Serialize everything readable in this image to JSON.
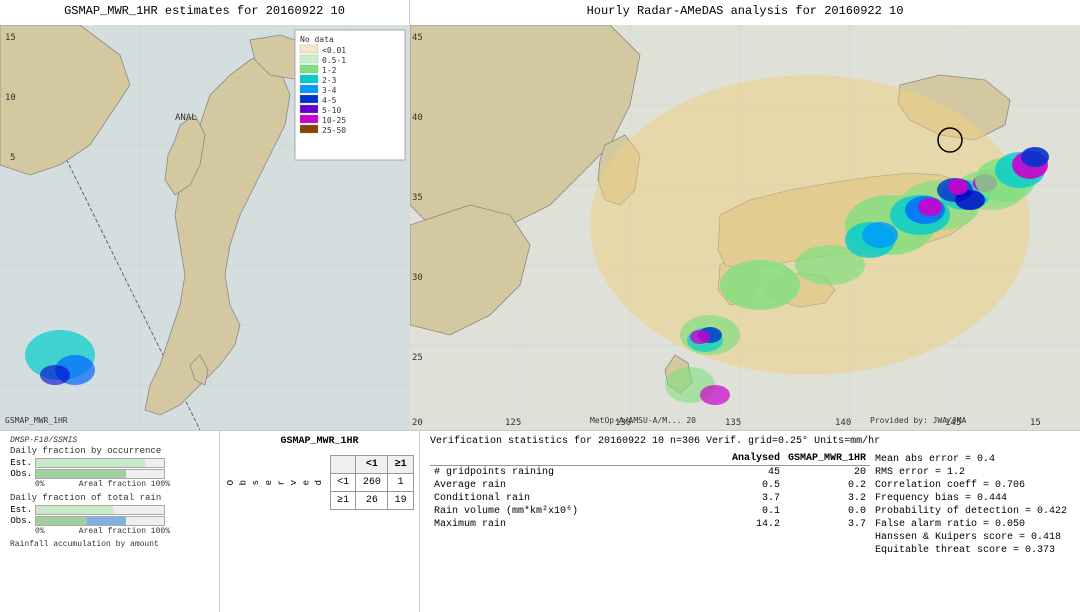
{
  "left_panel": {
    "title": "GSMAP_MWR_1HR estimates for 20160922 10",
    "label": "GSMAP_MWR_1HR",
    "sub_label": "ANAL",
    "source_label": "DMSP-F18/SSMIS"
  },
  "right_panel": {
    "title": "Hourly Radar-AMeDAS analysis for 20160922 10",
    "bottom_label": "MetOp-A/AMSU-A/M... 20",
    "credit": "Provided by: JWA/JMA"
  },
  "legend": {
    "title": "No data",
    "items": [
      {
        "label": "<0.01",
        "color": "#f5e6c8"
      },
      {
        "label": "0.5-1",
        "color": "#c8f0c8"
      },
      {
        "label": "1-2",
        "color": "#80e080"
      },
      {
        "label": "2-3",
        "color": "#00cccc"
      },
      {
        "label": "3-4",
        "color": "#0099ff"
      },
      {
        "label": "4-5",
        "color": "#0033cc"
      },
      {
        "label": "5-10",
        "color": "#6600cc"
      },
      {
        "label": "10-25",
        "color": "#cc00cc"
      },
      {
        "label": "25-50",
        "color": "#884400"
      }
    ]
  },
  "histogram": {
    "title1": "Daily fraction by occurrence",
    "est_bar1": 85,
    "obs_bar1": 70,
    "title2": "Daily fraction of total rain",
    "est_bar2": 60,
    "obs_bar2_green": 40,
    "obs_bar2_blue": 30,
    "axis_left": "0%",
    "axis_right": "Areal fraction 100%",
    "axis2_left": "0%",
    "axis2_right": "Areal fraction 100%",
    "sub_label": "Rainfall accumulation by amount"
  },
  "contingency": {
    "title": "GSMAP_MWR_1HR",
    "col_header1": "<1",
    "col_header2": "≥1",
    "row1_label": "<1",
    "row2_label": "≥1",
    "cell_11": "260",
    "cell_12": "1",
    "cell_21": "26",
    "cell_22": "19",
    "obs_label_lines": [
      "O",
      "b",
      "s",
      "e",
      "r",
      "v",
      "e",
      "d"
    ]
  },
  "verification": {
    "title": "Verification statistics for 20160922 10  n=306  Verif. grid=0.25°  Units=mm/hr",
    "col_header1": "Analysed",
    "col_header2": "GSMAP_MWR_1HR",
    "rows": [
      {
        "label": "# gridpoints raining",
        "val1": "45",
        "val2": "20"
      },
      {
        "label": "Average rain",
        "val1": "0.5",
        "val2": "0.2"
      },
      {
        "label": "Conditional rain",
        "val1": "3.7",
        "val2": "3.2"
      },
      {
        "label": "Rain volume (mm*km²x10⁶)",
        "val1": "0.1",
        "val2": "0.0"
      },
      {
        "label": "Maximum rain",
        "val1": "14.2",
        "val2": "3.7"
      }
    ],
    "stats": [
      {
        "label": "Mean abs error = 0.4"
      },
      {
        "label": "RMS error = 1.2"
      },
      {
        "label": "Correlation coeff = 0.706"
      },
      {
        "label": "Frequency bias = 0.444"
      },
      {
        "label": "Probability of detection = 0.422"
      },
      {
        "label": "False alarm ratio = 0.050"
      },
      {
        "label": "Hanssen & Kuipers score = 0.418"
      },
      {
        "label": "Equitable threat score = 0.373"
      }
    ]
  }
}
